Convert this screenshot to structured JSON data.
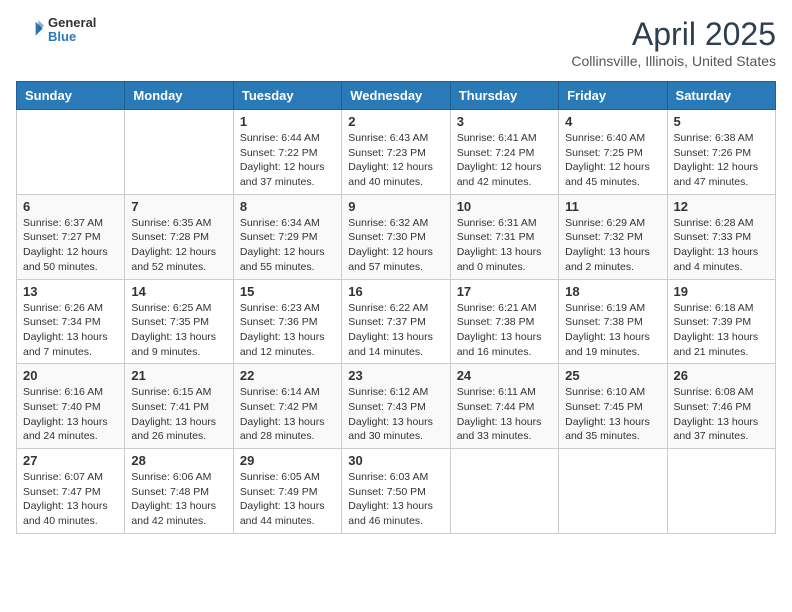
{
  "header": {
    "logo_line1": "General",
    "logo_line2": "Blue",
    "title": "April 2025",
    "location": "Collinsville, Illinois, United States"
  },
  "weekdays": [
    "Sunday",
    "Monday",
    "Tuesday",
    "Wednesday",
    "Thursday",
    "Friday",
    "Saturday"
  ],
  "weeks": [
    [
      {
        "day": "",
        "sunrise": "",
        "sunset": "",
        "daylight": ""
      },
      {
        "day": "",
        "sunrise": "",
        "sunset": "",
        "daylight": ""
      },
      {
        "day": "1",
        "sunrise": "Sunrise: 6:44 AM",
        "sunset": "Sunset: 7:22 PM",
        "daylight": "Daylight: 12 hours and 37 minutes."
      },
      {
        "day": "2",
        "sunrise": "Sunrise: 6:43 AM",
        "sunset": "Sunset: 7:23 PM",
        "daylight": "Daylight: 12 hours and 40 minutes."
      },
      {
        "day": "3",
        "sunrise": "Sunrise: 6:41 AM",
        "sunset": "Sunset: 7:24 PM",
        "daylight": "Daylight: 12 hours and 42 minutes."
      },
      {
        "day": "4",
        "sunrise": "Sunrise: 6:40 AM",
        "sunset": "Sunset: 7:25 PM",
        "daylight": "Daylight: 12 hours and 45 minutes."
      },
      {
        "day": "5",
        "sunrise": "Sunrise: 6:38 AM",
        "sunset": "Sunset: 7:26 PM",
        "daylight": "Daylight: 12 hours and 47 minutes."
      }
    ],
    [
      {
        "day": "6",
        "sunrise": "Sunrise: 6:37 AM",
        "sunset": "Sunset: 7:27 PM",
        "daylight": "Daylight: 12 hours and 50 minutes."
      },
      {
        "day": "7",
        "sunrise": "Sunrise: 6:35 AM",
        "sunset": "Sunset: 7:28 PM",
        "daylight": "Daylight: 12 hours and 52 minutes."
      },
      {
        "day": "8",
        "sunrise": "Sunrise: 6:34 AM",
        "sunset": "Sunset: 7:29 PM",
        "daylight": "Daylight: 12 hours and 55 minutes."
      },
      {
        "day": "9",
        "sunrise": "Sunrise: 6:32 AM",
        "sunset": "Sunset: 7:30 PM",
        "daylight": "Daylight: 12 hours and 57 minutes."
      },
      {
        "day": "10",
        "sunrise": "Sunrise: 6:31 AM",
        "sunset": "Sunset: 7:31 PM",
        "daylight": "Daylight: 13 hours and 0 minutes."
      },
      {
        "day": "11",
        "sunrise": "Sunrise: 6:29 AM",
        "sunset": "Sunset: 7:32 PM",
        "daylight": "Daylight: 13 hours and 2 minutes."
      },
      {
        "day": "12",
        "sunrise": "Sunrise: 6:28 AM",
        "sunset": "Sunset: 7:33 PM",
        "daylight": "Daylight: 13 hours and 4 minutes."
      }
    ],
    [
      {
        "day": "13",
        "sunrise": "Sunrise: 6:26 AM",
        "sunset": "Sunset: 7:34 PM",
        "daylight": "Daylight: 13 hours and 7 minutes."
      },
      {
        "day": "14",
        "sunrise": "Sunrise: 6:25 AM",
        "sunset": "Sunset: 7:35 PM",
        "daylight": "Daylight: 13 hours and 9 minutes."
      },
      {
        "day": "15",
        "sunrise": "Sunrise: 6:23 AM",
        "sunset": "Sunset: 7:36 PM",
        "daylight": "Daylight: 13 hours and 12 minutes."
      },
      {
        "day": "16",
        "sunrise": "Sunrise: 6:22 AM",
        "sunset": "Sunset: 7:37 PM",
        "daylight": "Daylight: 13 hours and 14 minutes."
      },
      {
        "day": "17",
        "sunrise": "Sunrise: 6:21 AM",
        "sunset": "Sunset: 7:38 PM",
        "daylight": "Daylight: 13 hours and 16 minutes."
      },
      {
        "day": "18",
        "sunrise": "Sunrise: 6:19 AM",
        "sunset": "Sunset: 7:38 PM",
        "daylight": "Daylight: 13 hours and 19 minutes."
      },
      {
        "day": "19",
        "sunrise": "Sunrise: 6:18 AM",
        "sunset": "Sunset: 7:39 PM",
        "daylight": "Daylight: 13 hours and 21 minutes."
      }
    ],
    [
      {
        "day": "20",
        "sunrise": "Sunrise: 6:16 AM",
        "sunset": "Sunset: 7:40 PM",
        "daylight": "Daylight: 13 hours and 24 minutes."
      },
      {
        "day": "21",
        "sunrise": "Sunrise: 6:15 AM",
        "sunset": "Sunset: 7:41 PM",
        "daylight": "Daylight: 13 hours and 26 minutes."
      },
      {
        "day": "22",
        "sunrise": "Sunrise: 6:14 AM",
        "sunset": "Sunset: 7:42 PM",
        "daylight": "Daylight: 13 hours and 28 minutes."
      },
      {
        "day": "23",
        "sunrise": "Sunrise: 6:12 AM",
        "sunset": "Sunset: 7:43 PM",
        "daylight": "Daylight: 13 hours and 30 minutes."
      },
      {
        "day": "24",
        "sunrise": "Sunrise: 6:11 AM",
        "sunset": "Sunset: 7:44 PM",
        "daylight": "Daylight: 13 hours and 33 minutes."
      },
      {
        "day": "25",
        "sunrise": "Sunrise: 6:10 AM",
        "sunset": "Sunset: 7:45 PM",
        "daylight": "Daylight: 13 hours and 35 minutes."
      },
      {
        "day": "26",
        "sunrise": "Sunrise: 6:08 AM",
        "sunset": "Sunset: 7:46 PM",
        "daylight": "Daylight: 13 hours and 37 minutes."
      }
    ],
    [
      {
        "day": "27",
        "sunrise": "Sunrise: 6:07 AM",
        "sunset": "Sunset: 7:47 PM",
        "daylight": "Daylight: 13 hours and 40 minutes."
      },
      {
        "day": "28",
        "sunrise": "Sunrise: 6:06 AM",
        "sunset": "Sunset: 7:48 PM",
        "daylight": "Daylight: 13 hours and 42 minutes."
      },
      {
        "day": "29",
        "sunrise": "Sunrise: 6:05 AM",
        "sunset": "Sunset: 7:49 PM",
        "daylight": "Daylight: 13 hours and 44 minutes."
      },
      {
        "day": "30",
        "sunrise": "Sunrise: 6:03 AM",
        "sunset": "Sunset: 7:50 PM",
        "daylight": "Daylight: 13 hours and 46 minutes."
      },
      {
        "day": "",
        "sunrise": "",
        "sunset": "",
        "daylight": ""
      },
      {
        "day": "",
        "sunrise": "",
        "sunset": "",
        "daylight": ""
      },
      {
        "day": "",
        "sunrise": "",
        "sunset": "",
        "daylight": ""
      }
    ]
  ]
}
